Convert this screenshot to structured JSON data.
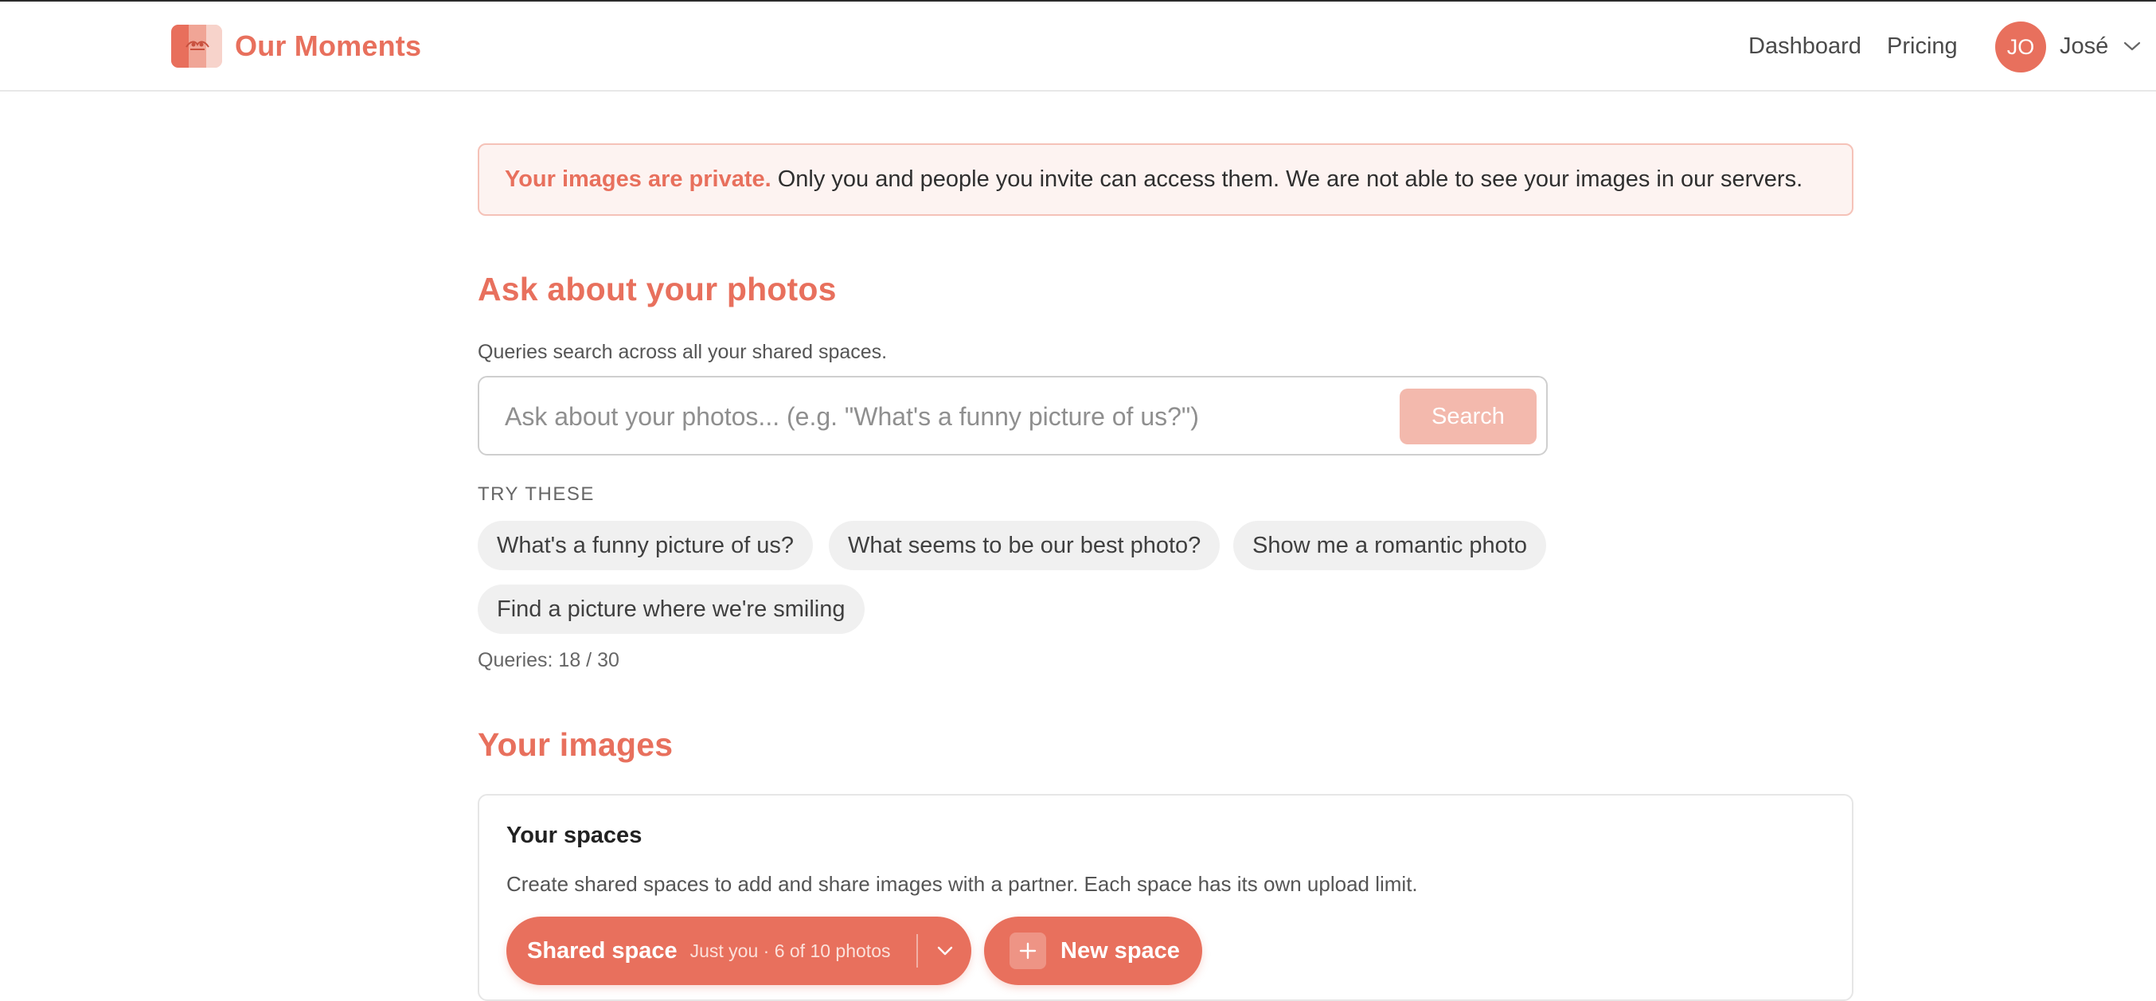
{
  "header": {
    "brand_name": "Our Moments",
    "nav": {
      "dashboard": "Dashboard",
      "pricing": "Pricing"
    },
    "user": {
      "initials": "JO",
      "name": "José"
    }
  },
  "privacy_banner": {
    "strong": "Your images are private.",
    "text": "Only you and people you invite can access them. We are not able to see your images in our servers."
  },
  "ask": {
    "title": "Ask about your photos",
    "subtitle": "Queries search across all your shared spaces.",
    "placeholder": "Ask about your photos... (e.g. \"What's a funny picture of us?\")",
    "search_label": "Search",
    "try_label": "TRY THESE",
    "suggestions": [
      "What's a funny picture of us?",
      "What seems to be our best photo?",
      "Show me a romantic photo",
      "Find a picture where we're smiling"
    ],
    "queries_text": "Queries: 18 / 30"
  },
  "images": {
    "title": "Your images",
    "spaces": {
      "title": "Your spaces",
      "description": "Create shared spaces to add and share images with a partner. Each space has its own upload limit.",
      "current_space": {
        "name": "Shared space",
        "meta": "Just you · 6 of 10 photos"
      },
      "new_space_label": "New space"
    }
  },
  "colors": {
    "accent": "#e8705d",
    "accent_light": "#f3b9ad",
    "banner_bg": "#fdf3f1",
    "banner_border": "#f5c2b8",
    "chip_bg": "#f0f0f0"
  },
  "icons": {
    "logo": "couple-photo-logo-icon",
    "user_menu": "chevron-down-icon",
    "space_menu": "chevron-down-icon",
    "new_space": "plus-icon"
  }
}
